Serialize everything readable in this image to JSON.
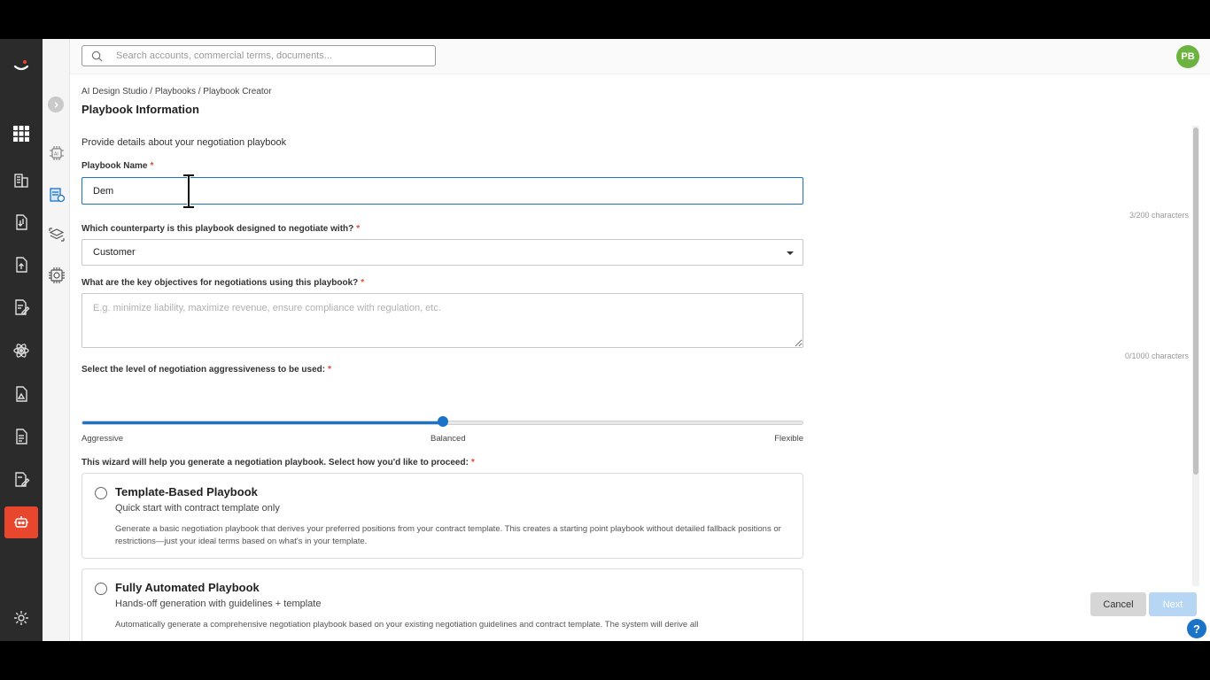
{
  "topbar": {
    "search_placeholder": "Search accounts, commercial terms, documents...",
    "avatar_initials": "PB"
  },
  "breadcrumb": "AI Design Studio / Playbooks / Playbook Creator",
  "page_title": "Playbook Information",
  "description": "Provide details about your negotiation playbook",
  "playbook_name": {
    "label": "Playbook Name",
    "value": "Dem",
    "counter": "3/200 characters"
  },
  "counterparty": {
    "label": "Which counterparty is this playbook designed to negotiate with?",
    "value": "Customer"
  },
  "objectives": {
    "label": "What are the key objectives for negotiations using this playbook?",
    "placeholder": "E.g. minimize liability, maximize revenue, ensure compliance with regulation, etc.",
    "counter": "0/1000 characters"
  },
  "aggressiveness": {
    "label": "Select the level of negotiation aggressiveness to be used:",
    "value_fraction": 0.5,
    "ticks": [
      "Aggressive",
      "Balanced",
      "Flexible"
    ]
  },
  "wizard": {
    "label": "This wizard will help you generate a negotiation playbook. Select how you'd like to proceed:",
    "options": [
      {
        "title": "Template-Based Playbook",
        "subtitle": "Quick start with contract template only",
        "body": "Generate a basic negotiation playbook that derives your preferred positions from your contract template. This creates a starting point playbook without detailed fallback positions or restrictions—just your ideal terms based on what's in your template."
      },
      {
        "title": "Fully Automated Playbook",
        "subtitle": "Hands-off generation with guidelines + template",
        "body": "Automatically generate a comprehensive negotiation playbook based on your existing negotiation guidelines and contract template. The system will derive all"
      }
    ]
  },
  "footer": {
    "cancel_label": "Cancel",
    "next_label": "Next",
    "help_label": "?"
  },
  "colors": {
    "accent": "#1a73c8",
    "brand": "#e8472d",
    "avatar": "#6cb33f"
  }
}
